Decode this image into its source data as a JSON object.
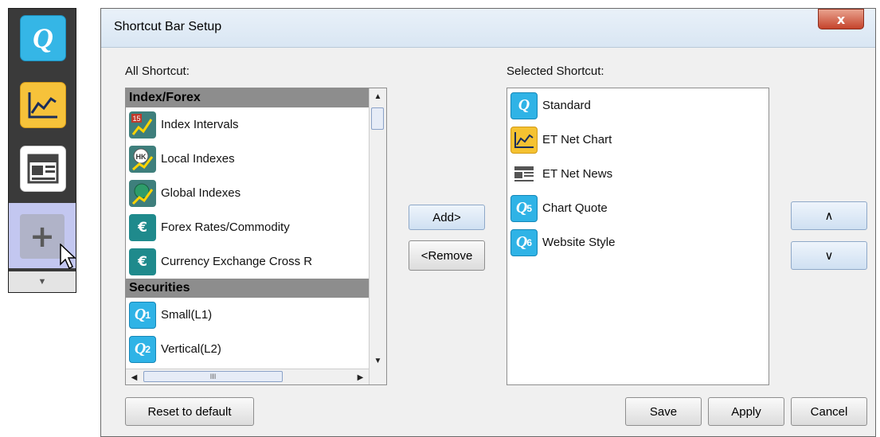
{
  "shortcut_bar": {
    "standard_icon_glyph": "Q",
    "add_glyph": "+",
    "expand_glyph": "▼",
    "icons": [
      "q-quote-icon",
      "line-chart-icon",
      "news-icon",
      "plus-icon",
      "chevron-down-icon"
    ]
  },
  "dialog": {
    "title": "Shortcut Bar Setup",
    "close_glyph": "x",
    "all_shortcut_label": "All Shortcut:",
    "selected_shortcut_label": "Selected Shortcut:",
    "all_list": {
      "group1": "Index/Forex",
      "group1_items": [
        {
          "label": "Index Intervals",
          "icon": "index-intervals-icon"
        },
        {
          "label": "Local Indexes",
          "icon": "local-indexes-icon"
        },
        {
          "label": "Global Indexes",
          "icon": "global-indexes-icon"
        },
        {
          "label": "Forex Rates/Commodity",
          "icon": "forex-icon"
        },
        {
          "label": "Currency Exchange Cross R",
          "icon": "forex-icon"
        }
      ],
      "group2": "Securities",
      "group2_items": [
        {
          "label": "Small(L1)",
          "icon": "q1-icon"
        },
        {
          "label": "Vertical(L2)",
          "icon": "q2-icon"
        }
      ],
      "hscroll_glyph": "III"
    },
    "selected_list": [
      {
        "label": "Standard",
        "icon": "q-quote-icon"
      },
      {
        "label": "ET Net Chart",
        "icon": "line-chart-icon"
      },
      {
        "label": "ET Net News",
        "icon": "news-icon"
      },
      {
        "label": "Chart Quote",
        "icon": "q5-icon"
      },
      {
        "label": "Website Style",
        "icon": "q6-icon"
      }
    ],
    "buttons": {
      "add": "Add>",
      "remove": "<Remove",
      "up": "∧",
      "down": "∨",
      "reset": "Reset to default",
      "save": "Save",
      "apply": "Apply",
      "cancel": "Cancel"
    },
    "badges": {
      "hk": "HK",
      "num15": "15",
      "q": "Q",
      "euro": "€",
      "sub1": "1",
      "sub2": "2",
      "sub5": "5",
      "sub6": "6"
    }
  }
}
